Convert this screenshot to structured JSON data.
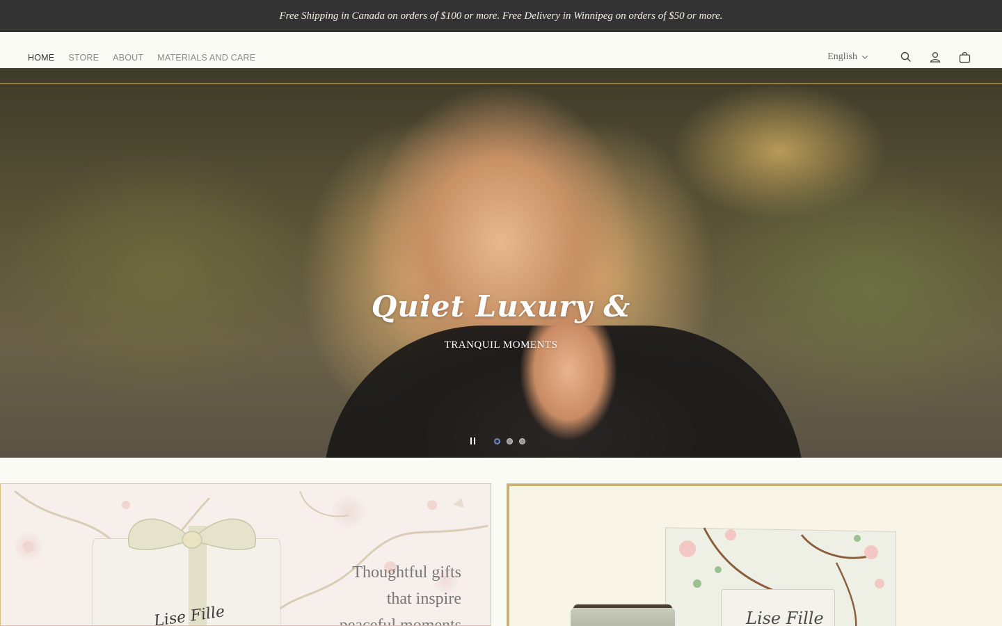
{
  "announcement": {
    "text": "Free Shipping in Canada on orders of $100 or more. Free Delivery in Winnipeg on orders of $50 or more."
  },
  "nav": {
    "items": [
      {
        "label": "HOME",
        "active": true
      },
      {
        "label": "STORE",
        "active": false
      },
      {
        "label": "ABOUT",
        "active": false
      },
      {
        "label": "MATERIALS AND CARE",
        "active": false
      }
    ]
  },
  "header": {
    "language": "English",
    "icons": [
      "search-icon",
      "account-icon",
      "cart-icon"
    ]
  },
  "hero": {
    "title": "Quiet Luxury &",
    "subtitle": "TRANQUIL MOMENTS",
    "slides_total": 3,
    "active_slide": 1
  },
  "cards": {
    "left": {
      "line1": "Thoughtful gifts",
      "line2": "that inspire",
      "line3": "peaceful moments",
      "box_label": "Lise Fille"
    },
    "right": {
      "brand": "Lise Fille"
    }
  },
  "colors": {
    "announcement_bg": "#333333",
    "accent_gold": "#c8b176",
    "page_bg": "#fbfbf6",
    "active_dot": "#1f2b48"
  }
}
